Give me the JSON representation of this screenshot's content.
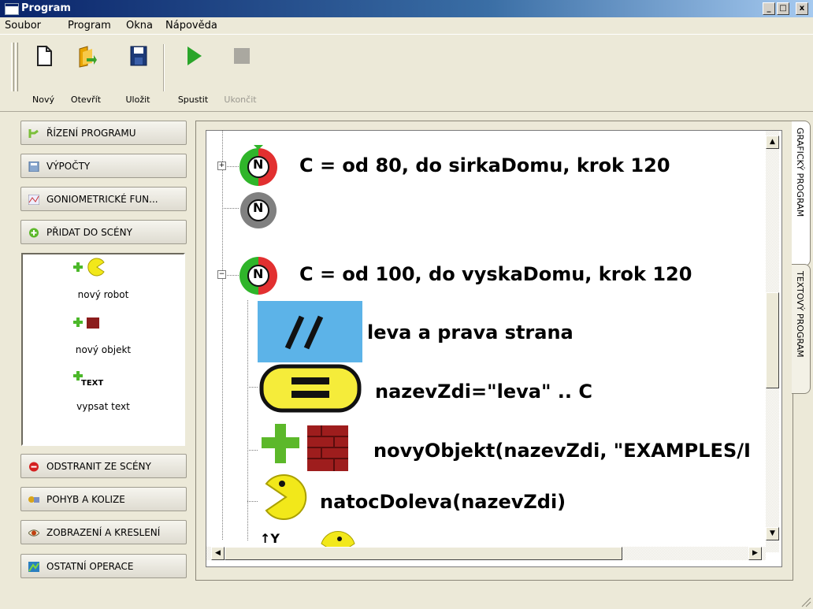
{
  "window": {
    "title": "Program",
    "minimize": "_",
    "maximize": "□",
    "close": "x"
  },
  "menu": [
    "Soubor",
    "Program",
    "Okna",
    "Nápověda"
  ],
  "toolbar": {
    "new": "Nový",
    "open": "Otevřít",
    "save": "Uložit",
    "run": "Spustit",
    "stop": "Ukončit"
  },
  "categories": {
    "program_control": "ŘÍZENÍ PROGRAMU",
    "calculations": "VÝPOČTY",
    "goniometric": "GONIOMETRICKÉ FUN...",
    "add_to_scene": "PŘIDAT DO SCÉNY",
    "remove_from_scene": "ODSTRANIT ZE SCÉNY",
    "movement": "POHYB A KOLIZE",
    "display": "ZOBRAZENÍ A KRESLENÍ",
    "other": "OSTATNÍ OPERACE"
  },
  "add_items": {
    "new_robot": "nový robot",
    "new_object": "nový objekt",
    "print_text": "vypsat text",
    "text_badge": "TEXT"
  },
  "program": {
    "loop1": "C = od 80, do sirkaDomu, krok 120",
    "loop_node_letter": "N",
    "loop2": "C = od 100, do vyskaDomu, krok 120",
    "comment": "leva a prava strana",
    "assign": "nazevZdi=\"leva\" .. C",
    "new_object": "novyObjekt(nazevZdi, \"EXAMPLES/I",
    "rotate_left": "natocDoleva(nazevZdi)",
    "partial_label": "↑Y",
    "expand_plus": "+",
    "collapse_minus": "−"
  },
  "tabs": {
    "graphic": "GRAFICKÝ PROGRAM",
    "text": "TEXTOVÝ PROGRAM"
  }
}
